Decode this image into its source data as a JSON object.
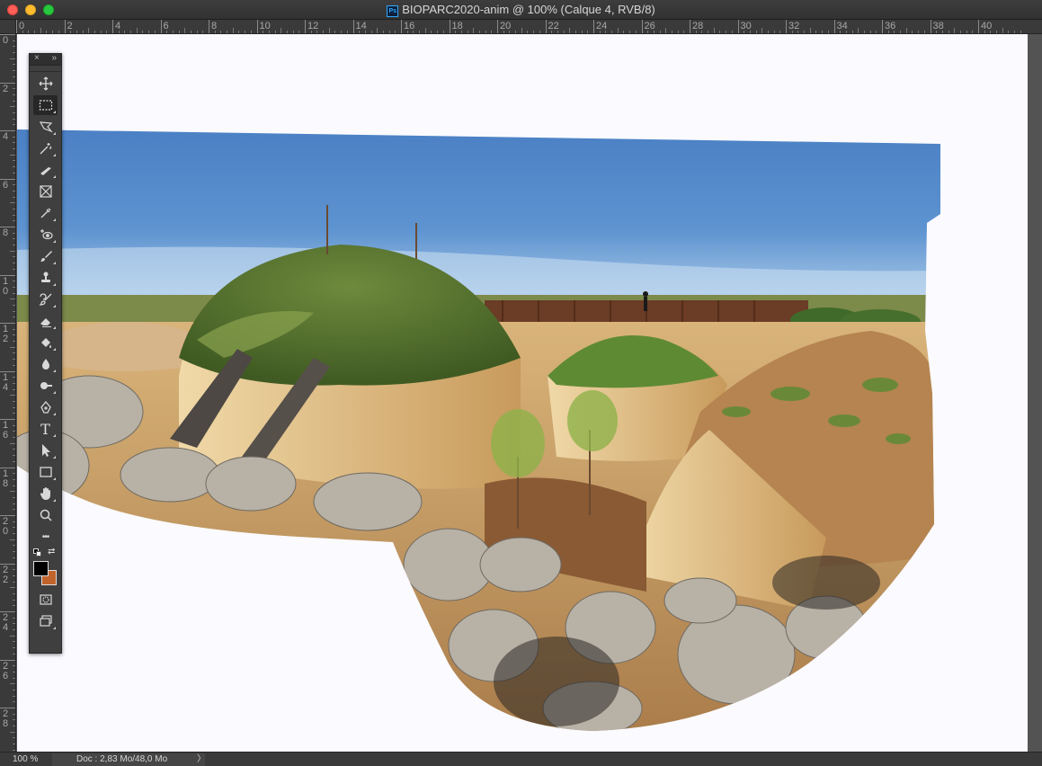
{
  "window": {
    "title": "BIOPARC2020-anim @ 100% (Calque 4, RVB/8)",
    "app_badge": "Ps"
  },
  "ruler": {
    "units": "cm",
    "h_labels": [
      "0",
      "2",
      "4",
      "6",
      "8",
      "10",
      "12",
      "14",
      "16",
      "18",
      "20",
      "22",
      "24",
      "26",
      "28",
      "30",
      "32",
      "34",
      "36",
      "38",
      "40"
    ],
    "v_labels": [
      "0",
      "2",
      "4",
      "6",
      "8",
      "10",
      "12",
      "14",
      "16",
      "18",
      "20",
      "22",
      "24",
      "26",
      "28"
    ]
  },
  "tools_panel": {
    "close_glyph": "×",
    "expand_glyph": "»",
    "tools": [
      {
        "name": "move-tool",
        "icon": "move-icon"
      },
      {
        "name": "rectangular-marquee-tool",
        "icon": "marquee-icon",
        "active": true
      },
      {
        "name": "lasso-tool",
        "icon": "polygonal-lasso-icon"
      },
      {
        "name": "magic-wand-tool",
        "icon": "magic-wand-icon"
      },
      {
        "name": "slice-tool",
        "icon": "slice-icon"
      },
      {
        "name": "frame-tool",
        "icon": "frame-icon"
      },
      {
        "name": "eyedropper-tool",
        "icon": "eyedropper-icon"
      },
      {
        "name": "red-eye-tool",
        "icon": "red-eye-icon"
      },
      {
        "name": "brush-tool",
        "icon": "brush-icon"
      },
      {
        "name": "clone-stamp-tool",
        "icon": "stamp-icon"
      },
      {
        "name": "history-brush-tool",
        "icon": "history-brush-icon"
      },
      {
        "name": "eraser-tool",
        "icon": "eraser-icon"
      },
      {
        "name": "paint-bucket-tool",
        "icon": "paint-bucket-icon"
      },
      {
        "name": "blur-tool",
        "icon": "blur-drop-icon"
      },
      {
        "name": "dodge-tool",
        "icon": "dodge-icon"
      },
      {
        "name": "pen-tool",
        "icon": "pen-icon"
      },
      {
        "name": "type-tool",
        "icon": "type-icon",
        "glyph": "T"
      },
      {
        "name": "path-selection-tool",
        "icon": "arrow-icon"
      },
      {
        "name": "rectangle-tool",
        "icon": "rectangle-icon"
      },
      {
        "name": "hand-tool",
        "icon": "hand-icon"
      },
      {
        "name": "zoom-tool",
        "icon": "zoom-icon"
      },
      {
        "name": "edit-toolbar",
        "icon": "more-icon",
        "glyph": "•••"
      }
    ],
    "foreground_color": "#000000",
    "background_color": "#c0642c",
    "quick_mask_icon": "quick-mask-icon",
    "screen_mode_icon": "screen-mode-icon"
  },
  "status": {
    "zoom": "100 %",
    "doc_info": "Doc : 2,83 Mo/48,0 Mo",
    "arrow": "〉"
  },
  "document": {
    "background": "#fafaff",
    "description_colors": {
      "sky_top": "#4f86c8",
      "sky_bottom": "#cfe3f4",
      "soil": "#c9a06a",
      "grass": "#5e7a32",
      "rock": "#b9b2a6"
    }
  }
}
